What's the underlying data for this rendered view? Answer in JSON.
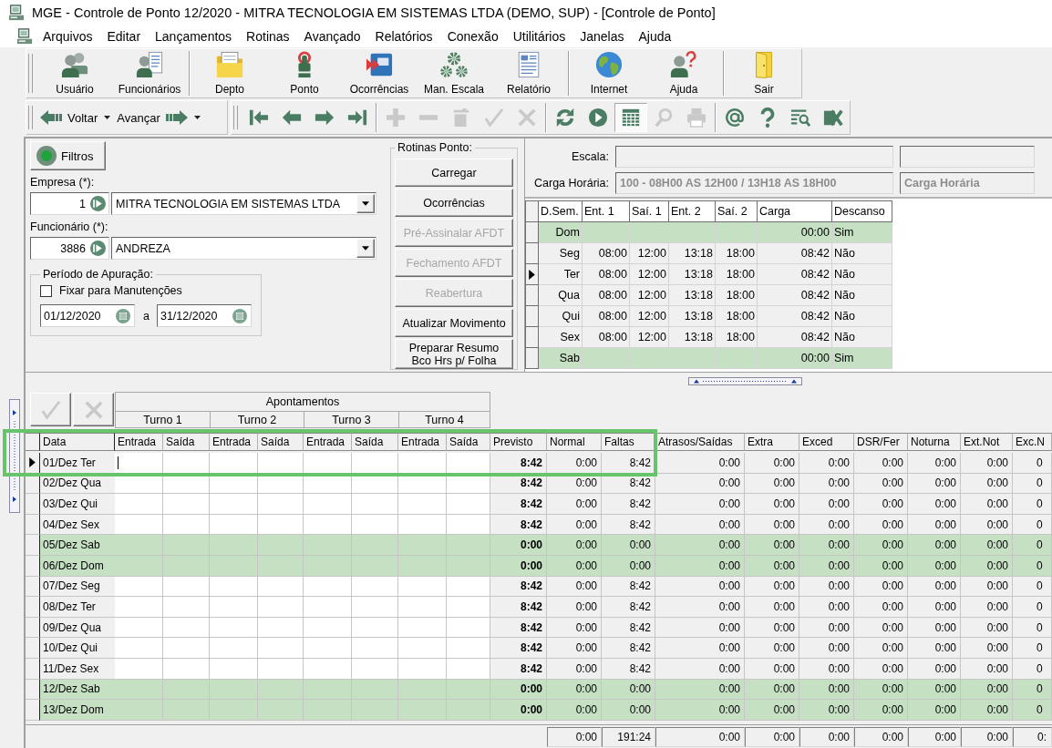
{
  "window": {
    "title": "MGE - Controle de Ponto 12/2020 - MITRA TECNOLOGIA EM SISTEMAS LTDA (DEMO, SUP) - [Controle de Ponto]"
  },
  "menu": [
    "Arquivos",
    "Editar",
    "Lançamentos",
    "Rotinas",
    "Avançado",
    "Relatórios",
    "Conexão",
    "Utilitários",
    "Janelas",
    "Ajuda"
  ],
  "main_toolbar": {
    "groups": [
      {
        "buttons": [
          {
            "label": "Usuário",
            "kind": "users"
          },
          {
            "label": "Funcionários",
            "kind": "employees"
          }
        ]
      },
      {
        "buttons": [
          {
            "label": "Depto",
            "kind": "folder"
          },
          {
            "label": "Ponto",
            "kind": "punch"
          },
          {
            "label": "Ocorrências",
            "kind": "events"
          },
          {
            "label": "Man. Escala",
            "kind": "gears"
          },
          {
            "label": "Relatório",
            "kind": "report"
          }
        ]
      },
      {
        "buttons": [
          {
            "label": "Internet",
            "kind": "globe"
          },
          {
            "label": "Ajuda",
            "kind": "help"
          }
        ]
      },
      {
        "buttons": [
          {
            "label": "Sair",
            "kind": "exit"
          }
        ]
      }
    ]
  },
  "nav_toolbar": {
    "history": [
      {
        "label": "Voltar",
        "kind": "back"
      },
      {
        "label": "Avançar",
        "kind": "forward"
      }
    ],
    "groups": [
      {
        "buttons": [
          {
            "kind": "first",
            "disabled": false,
            "pressed": false
          },
          {
            "kind": "previous",
            "disabled": false,
            "pressed": false
          },
          {
            "kind": "next",
            "disabled": false,
            "pressed": false
          },
          {
            "kind": "last",
            "disabled": false,
            "pressed": false
          }
        ]
      },
      {
        "buttons": [
          {
            "kind": "add",
            "disabled": true,
            "pressed": false
          },
          {
            "kind": "remove",
            "disabled": true,
            "pressed": false
          },
          {
            "kind": "delete",
            "disabled": true,
            "pressed": false
          },
          {
            "kind": "confirm",
            "disabled": true,
            "pressed": false
          },
          {
            "kind": "cancel",
            "disabled": true,
            "pressed": false
          }
        ]
      },
      {
        "buttons": [
          {
            "kind": "refresh",
            "disabled": false,
            "pressed": false
          },
          {
            "kind": "play",
            "disabled": false,
            "pressed": false
          },
          {
            "kind": "grid",
            "disabled": false,
            "pressed": true
          },
          {
            "kind": "search",
            "disabled": true,
            "pressed": false
          },
          {
            "kind": "print",
            "disabled": true,
            "pressed": false
          }
        ]
      },
      {
        "buttons": [
          {
            "kind": "email",
            "disabled": false,
            "pressed": false
          },
          {
            "kind": "help",
            "disabled": false,
            "pressed": false
          },
          {
            "kind": "filter",
            "disabled": false,
            "pressed": false
          },
          {
            "kind": "excel",
            "disabled": false,
            "pressed": false
          }
        ]
      }
    ]
  },
  "filters_button": {
    "label": "Filtros"
  },
  "empresa": {
    "label": "Empresa (*):",
    "code": "1",
    "name": "MITRA TECNOLOGIA EM SISTEMAS LTDA"
  },
  "funcionario": {
    "label": "Funcionário (*):",
    "code": "3886",
    "name": "ANDREZA"
  },
  "periodo": {
    "title": "Período de Apuração:",
    "fix_checkbox": {
      "label": "Fixar para Manutenções",
      "checked": false
    },
    "start": "01/12/2020",
    "separator": "a",
    "end": "31/12/2020"
  },
  "rotinas": {
    "title": "Rotinas Ponto:",
    "buttons": [
      {
        "label": "Carregar",
        "disabled": false
      },
      {
        "label": "Ocorrências",
        "disabled": false
      },
      {
        "label": "Pré-Assinalar AFDT",
        "disabled": true
      },
      {
        "label": "Fechamento AFDT",
        "disabled": true
      },
      {
        "label": "Reabertura",
        "disabled": true
      },
      {
        "label": "Atualizar Movimento",
        "disabled": false
      },
      {
        "label": "Preparar Resumo\nBco Hrs p/ Folha",
        "disabled": false
      }
    ]
  },
  "schedule_info": [
    {
      "label": "Escala:",
      "fields": [
        {
          "disabled": true
        },
        {
          "disabled": true
        }
      ]
    },
    {
      "label": "Carga Horária:",
      "fields": [
        {
          "value": "100 - 08H00 AS 12H00 / 13H18 AS 18H00",
          "disabled": true
        },
        {
          "value": "Carga Horária",
          "disabled": true
        }
      ]
    }
  ],
  "schedule_table": {
    "columns": [
      "D.Sem.",
      "Ent. 1",
      "Saí. 1",
      "Ent. 2",
      "Saí. 2",
      "Carga",
      "Descanso"
    ],
    "rows": [
      {
        "day": "Dom",
        "carga": "00:00",
        "descanso": "Sim",
        "rest_day": true,
        "selected": false
      },
      {
        "day": "Seg",
        "ent1": "08:00",
        "sai1": "12:00",
        "ent2": "13:18",
        "sai2": "18:00",
        "carga": "08:42",
        "descanso": "Não",
        "rest_day": false,
        "selected": false
      },
      {
        "day": "Ter",
        "ent1": "08:00",
        "sai1": "12:00",
        "ent2": "13:18",
        "sai2": "18:00",
        "carga": "08:42",
        "descanso": "Não",
        "rest_day": false,
        "selected": true
      },
      {
        "day": "Qua",
        "ent1": "08:00",
        "sai1": "12:00",
        "ent2": "13:18",
        "sai2": "18:00",
        "carga": "08:42",
        "descanso": "Não",
        "rest_day": false,
        "selected": false
      },
      {
        "day": "Qui",
        "ent1": "08:00",
        "sai1": "12:00",
        "ent2": "13:18",
        "sai2": "18:00",
        "carga": "08:42",
        "descanso": "Não",
        "rest_day": false,
        "selected": false
      },
      {
        "day": "Sex",
        "ent1": "08:00",
        "sai1": "12:00",
        "ent2": "13:18",
        "sai2": "18:00",
        "carga": "08:42",
        "descanso": "Não",
        "rest_day": false,
        "selected": false
      },
      {
        "day": "Sab",
        "carga": "00:00",
        "descanso": "Sim",
        "rest_day": true,
        "selected": false
      }
    ]
  },
  "grid": {
    "highlight_frame": true,
    "actions": [
      {
        "kind": "confirm",
        "disabled": true
      },
      {
        "kind": "cancel",
        "disabled": true
      }
    ],
    "group_title": "Apontamentos",
    "shifts": [
      "Turno 1",
      "Turno 2",
      "Turno 3",
      "Turno 4"
    ],
    "columns": [
      "Data",
      "Entrada",
      "Saída",
      "Entrada",
      "Saída",
      "Entrada",
      "Saída",
      "Entrada",
      "Saída",
      "Previsto",
      "Normal",
      "Faltas",
      "Atrasos/Saídas",
      "Extra",
      "Exced",
      "DSR/Fer",
      "Noturna",
      "Ext.Not",
      "Exc.N"
    ],
    "rows": [
      {
        "date": "01/Dez Ter",
        "values": [
          "8:42",
          "0:00",
          "8:42",
          "0:00",
          "0:00",
          "0:00",
          "0:00",
          "0:00",
          "0:00",
          "0"
        ],
        "rest_day": false,
        "selected": true,
        "editing": true
      },
      {
        "date": "02/Dez Qua",
        "values": [
          "8:42",
          "0:00",
          "8:42",
          "0:00",
          "0:00",
          "0:00",
          "0:00",
          "0:00",
          "0:00",
          "0"
        ],
        "rest_day": false,
        "selected": false,
        "editing": false
      },
      {
        "date": "03/Dez Qui",
        "values": [
          "8:42",
          "0:00",
          "8:42",
          "0:00",
          "0:00",
          "0:00",
          "0:00",
          "0:00",
          "0:00",
          "0"
        ],
        "rest_day": false,
        "selected": false,
        "editing": false
      },
      {
        "date": "04/Dez Sex",
        "values": [
          "8:42",
          "0:00",
          "8:42",
          "0:00",
          "0:00",
          "0:00",
          "0:00",
          "0:00",
          "0:00",
          "0"
        ],
        "rest_day": false,
        "selected": false,
        "editing": false
      },
      {
        "date": "05/Dez Sab",
        "values": [
          "0:00",
          "0:00",
          "0:00",
          "0:00",
          "0:00",
          "0:00",
          "0:00",
          "0:00",
          "0:00",
          "0"
        ],
        "rest_day": true,
        "selected": false,
        "editing": false
      },
      {
        "date": "06/Dez Dom",
        "values": [
          "0:00",
          "0:00",
          "0:00",
          "0:00",
          "0:00",
          "0:00",
          "0:00",
          "0:00",
          "0:00",
          "0"
        ],
        "rest_day": true,
        "selected": false,
        "editing": false
      },
      {
        "date": "07/Dez Seg",
        "values": [
          "8:42",
          "0:00",
          "8:42",
          "0:00",
          "0:00",
          "0:00",
          "0:00",
          "0:00",
          "0:00",
          "0"
        ],
        "rest_day": false,
        "selected": false,
        "editing": false
      },
      {
        "date": "08/Dez Ter",
        "values": [
          "8:42",
          "0:00",
          "8:42",
          "0:00",
          "0:00",
          "0:00",
          "0:00",
          "0:00",
          "0:00",
          "0"
        ],
        "rest_day": false,
        "selected": false,
        "editing": false
      },
      {
        "date": "09/Dez Qua",
        "values": [
          "8:42",
          "0:00",
          "8:42",
          "0:00",
          "0:00",
          "0:00",
          "0:00",
          "0:00",
          "0:00",
          "0"
        ],
        "rest_day": false,
        "selected": false,
        "editing": false
      },
      {
        "date": "10/Dez Qui",
        "values": [
          "8:42",
          "0:00",
          "8:42",
          "0:00",
          "0:00",
          "0:00",
          "0:00",
          "0:00",
          "0:00",
          "0"
        ],
        "rest_day": false,
        "selected": false,
        "editing": false
      },
      {
        "date": "11/Dez Sex",
        "values": [
          "8:42",
          "0:00",
          "8:42",
          "0:00",
          "0:00",
          "0:00",
          "0:00",
          "0:00",
          "0:00",
          "0"
        ],
        "rest_day": false,
        "selected": false,
        "editing": false
      },
      {
        "date": "12/Dez Sab",
        "values": [
          "0:00",
          "0:00",
          "0:00",
          "0:00",
          "0:00",
          "0:00",
          "0:00",
          "0:00",
          "0:00",
          "0"
        ],
        "rest_day": true,
        "selected": false,
        "editing": false
      },
      {
        "date": "13/Dez Dom",
        "values": [
          "0:00",
          "0:00",
          "0:00",
          "0:00",
          "0:00",
          "0:00",
          "0:00",
          "0:00",
          "0:00",
          "0"
        ],
        "rest_day": true,
        "selected": false,
        "editing": false
      }
    ],
    "totals": [
      "0:00",
      "191:24",
      "0:00",
      "0:00",
      "0:00",
      "0:00",
      "0:00",
      "0:00",
      "0:"
    ]
  }
}
